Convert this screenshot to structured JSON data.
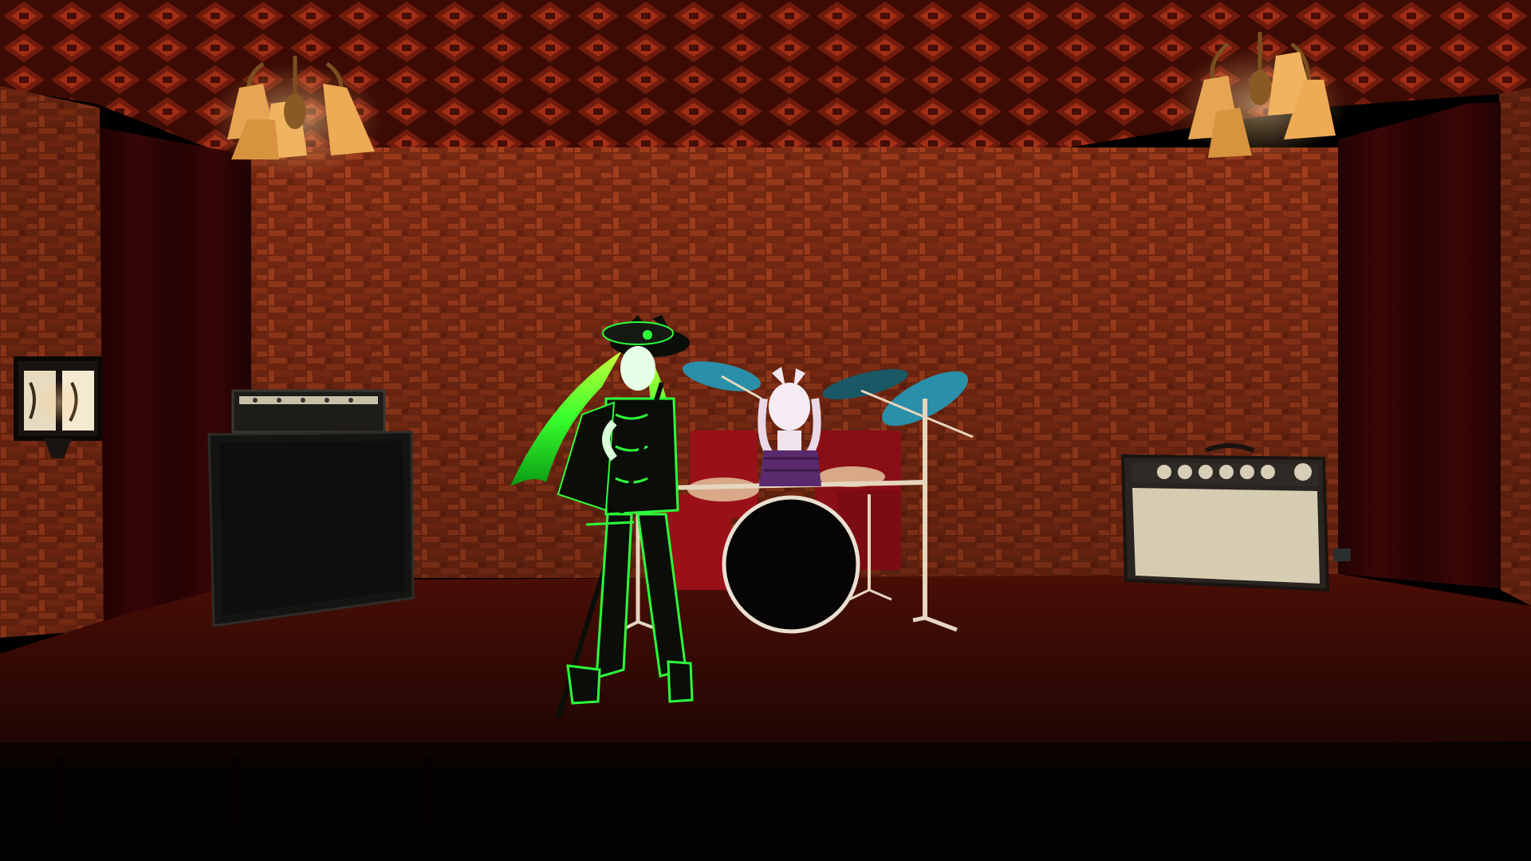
{
  "scene": {
    "type": "3d-game-screenshot",
    "description_visible_hud": "",
    "palette": {
      "ceiling": "#5a1208",
      "ceiling_pattern": "#b8321a",
      "brick": "#a83c1c",
      "brick_dark": "#6e2410",
      "curtain": "#3a0606",
      "stage_floor": "#3a0c06",
      "foreground": "#050202",
      "speaker_cab": "#1a1a18",
      "amp_face": "#d8cdb6",
      "drum_red": "#9a1018",
      "cymbal": "#2a8fa8",
      "chandelier_shade": "#e2a14a",
      "avatar_green": "#2cff3a",
      "avatar_black": "#0a0d08",
      "drummer_white": "#f2e6ee",
      "drummer_purple": "#5a2a6e"
    },
    "icons": {
      "left_chandelier": "chandelier-icon",
      "right_chandelier": "chandelier-icon",
      "wall_lamp": "wall-lamp-icon"
    }
  }
}
